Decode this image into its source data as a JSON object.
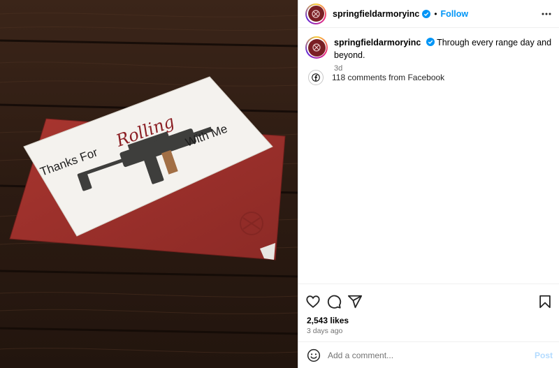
{
  "post": {
    "username": "springfieldarmoryinc",
    "follow_label": "Follow",
    "caption_text": "Through every range day and beyond.",
    "caption_age": "3d",
    "facebook_comments": "118 comments from Facebook",
    "likes": "2,543 likes",
    "posted_ago": "3 days ago"
  },
  "card": {
    "text_left": "Thanks For",
    "text_script": "Rolling",
    "text_right": "With Me"
  },
  "comment_box": {
    "placeholder": "Add a comment...",
    "post_label": "Post"
  },
  "colors": {
    "accent_blue": "#0095f6",
    "post_disabled": "#b3dbff",
    "envelope_red": "#9a2f2b",
    "brand_maroon": "#7a1f24"
  },
  "icons": [
    "verified-badge-icon",
    "more-options-icon",
    "facebook-icon",
    "heart-icon",
    "comment-icon",
    "share-icon",
    "bookmark-icon",
    "emoji-icon"
  ]
}
